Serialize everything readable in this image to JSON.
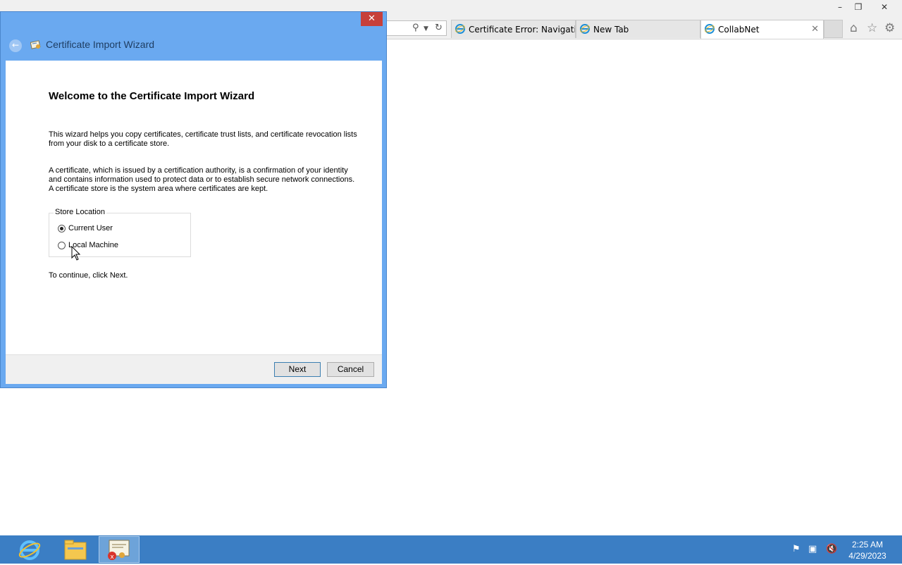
{
  "browser": {
    "window_controls": {
      "minimize": "–",
      "restore": "❐",
      "close": "✕"
    },
    "tabs": [
      {
        "label": "Certificate Error: Navigatio...",
        "active": false
      },
      {
        "label": "New Tab",
        "active": false
      },
      {
        "label": "CollabNet",
        "active": true
      }
    ],
    "tab_close": "✕"
  },
  "dialog": {
    "title": "Certificate Import Wizard",
    "close": "✕",
    "heading": "Welcome to the Certificate Import Wizard",
    "paragraph1": "This wizard helps you copy certificates, certificate trust lists, and certificate revocation lists from your disk to a certificate store.",
    "paragraph2": "A certificate, which is issued by a certification authority, is a confirmation of your identity and contains information used to protect data or to establish secure network connections. A certificate store is the system area where certificates are kept.",
    "store_location": {
      "legend": "Store Location",
      "options": [
        {
          "label": "Current User",
          "checked": true
        },
        {
          "label": "Local Machine",
          "checked": false
        }
      ]
    },
    "continue_text": "To continue, click Next.",
    "buttons": {
      "next": "Next",
      "cancel": "Cancel"
    }
  },
  "taskbar": {
    "time": "2:25 AM",
    "date": "4/29/2023"
  },
  "colors": {
    "dialog_frame": "#6aa9f0",
    "taskbar": "#3b7ec4",
    "close_button": "#c7403a"
  }
}
